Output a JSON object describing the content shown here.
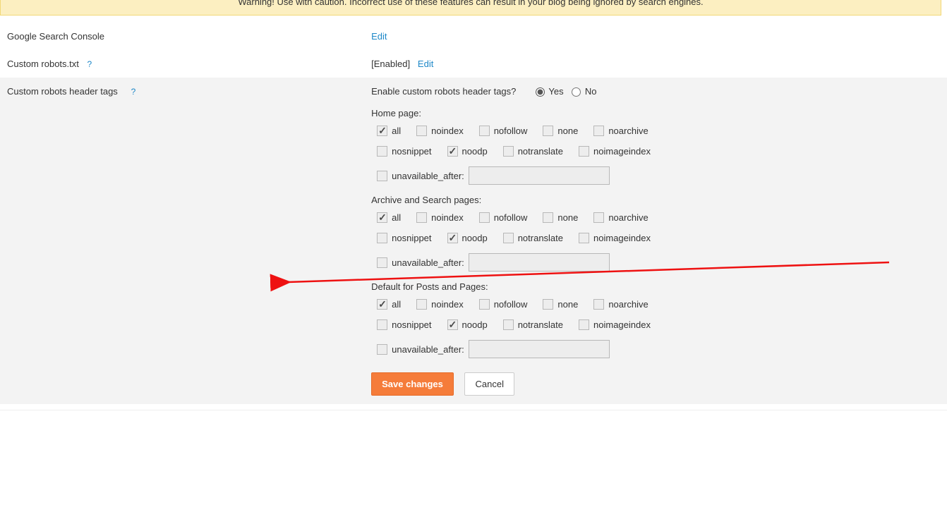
{
  "warning": "Warning! Use with caution. Incorrect use of these features can result in your blog being ignored by search engines.",
  "rows": {
    "gsc": {
      "label": "Google Search Console",
      "action": "Edit"
    },
    "robots_txt": {
      "label": "Custom robots.txt",
      "status": "[Enabled]",
      "action": "Edit"
    },
    "robots_tags": {
      "label": "Custom robots header tags"
    }
  },
  "enable_question": "Enable custom robots header tags?",
  "radio": {
    "yes": "Yes",
    "no": "No"
  },
  "sections": {
    "home": "Home page:",
    "archive": "Archive and Search pages:",
    "posts": "Default for Posts and Pages:"
  },
  "opts": {
    "all": "all",
    "noindex": "noindex",
    "nofollow": "nofollow",
    "none": "none",
    "noarchive": "noarchive",
    "nosnippet": "nosnippet",
    "noodp": "noodp",
    "notranslate": "notranslate",
    "noimageindex": "noimageindex",
    "unavailable_after": "unavailable_after:"
  },
  "buttons": {
    "save": "Save changes",
    "cancel": "Cancel"
  }
}
